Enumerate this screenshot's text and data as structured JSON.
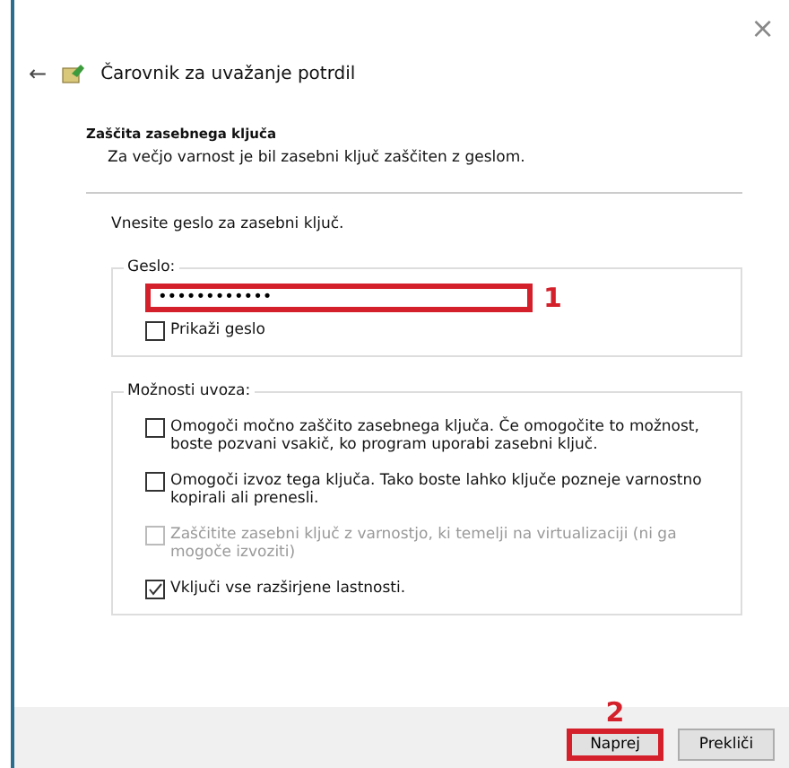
{
  "window": {
    "title": "Čarovnik za uvažanje potrdil",
    "close": "×",
    "back": "←"
  },
  "header": {
    "title": "Zaščita zasebnega ključa",
    "subtitle": "Za večjo varnost je bil zasebni ključ zaščiten z geslom."
  },
  "prompt": "Vnesite geslo za zasebni ključ.",
  "password_group": {
    "legend": "Geslo:",
    "value": "••••••••••••",
    "highlighted": true,
    "annotation": "1",
    "show_password": {
      "label": "Prikaži geslo",
      "checked": false
    }
  },
  "options_group": {
    "legend": "Možnosti uvoza:",
    "options": [
      {
        "label": "Omogoči močno zaščito zasebnega ključa. Če omogočite to možnost, boste pozvani vsakič, ko program uporabi zasebni ključ.",
        "checked": false,
        "disabled": false
      },
      {
        "label": "Omogoči izvoz tega ključa. Tako boste lahko ključe pozneje varnostno kopirali ali prenesli.",
        "checked": false,
        "disabled": false
      },
      {
        "label": "Zaščitite zasebni ključ z varnostjo, ki temelji na virtualizaciji (ni ga mogoče izvoziti)",
        "checked": false,
        "disabled": true
      },
      {
        "label": "Vključi vse razširjene lastnosti.",
        "checked": true,
        "disabled": false
      }
    ]
  },
  "buttons": [
    {
      "label": "Naprej",
      "highlighted": true,
      "annotation": "2"
    },
    {
      "label": "Prekliči",
      "highlighted": false
    }
  ]
}
